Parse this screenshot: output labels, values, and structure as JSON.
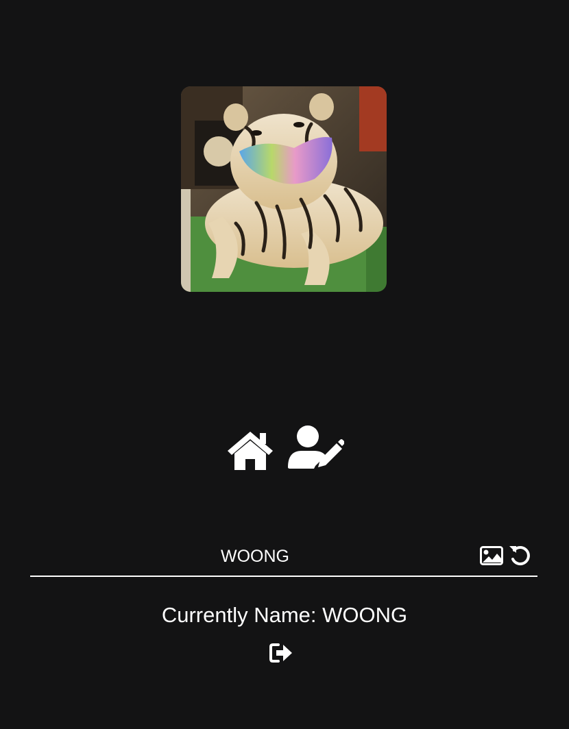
{
  "profile": {
    "avatar_alt": "profile photo",
    "name_value": "WOONG",
    "current_name_prefix": "Currently Name:",
    "current_name_value": "WOONG"
  },
  "nav": {
    "items": [
      {
        "icon": "home-icon"
      },
      {
        "icon": "user-edit-icon"
      }
    ]
  },
  "name_row": {
    "icons": [
      "image-icon",
      "undo-icon"
    ]
  },
  "colors": {
    "background": "#131314",
    "foreground": "#ffffff"
  }
}
